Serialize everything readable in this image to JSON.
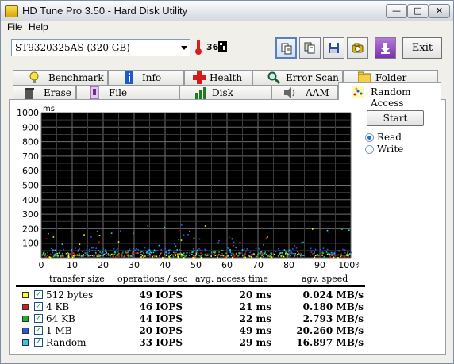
{
  "window": {
    "title": "HD Tune Pro 3.50 - Hard Disk Utility"
  },
  "menu": [
    {
      "label": "File"
    },
    {
      "label": "Help"
    }
  ],
  "toolbar": {
    "drive": "ST9320325AS (320 GB)",
    "temperature": "36",
    "temperature_unit_icon": "celsius-icon",
    "exit_label": "Exit"
  },
  "tabs_top": [
    {
      "label": "Benchmark",
      "icon": "lightbulb-icon"
    },
    {
      "label": "Info",
      "icon": "info-icon"
    },
    {
      "label": "Health",
      "icon": "red-cross-icon"
    },
    {
      "label": "Error Scan",
      "icon": "magnifier-icon"
    },
    {
      "label": "Folder Usage",
      "icon": "folder-icon"
    }
  ],
  "tabs_bottom": [
    {
      "label": "Erase",
      "icon": "trash-icon"
    },
    {
      "label": "File Benchmark",
      "icon": "file-benchmark-icon"
    },
    {
      "label": "Disk monitor",
      "icon": "bar-chart-icon"
    },
    {
      "label": "AAM",
      "icon": "speaker-icon"
    },
    {
      "label": "Random Access",
      "icon": "scatter-icon"
    }
  ],
  "controls": {
    "start_label": "Start",
    "read_label": "Read",
    "write_label": "Write",
    "selected_mode": "Read"
  },
  "chart_data": {
    "type": "scatter",
    "ylabel": "ms",
    "y_ticks": [
      "1000",
      "900",
      "800",
      "700",
      "600",
      "500",
      "400",
      "300",
      "200",
      "100"
    ],
    "x_ticks": [
      "0",
      "10",
      "20",
      "30",
      "40",
      "50",
      "60",
      "70",
      "80",
      "90",
      "100%"
    ],
    "xlim": [
      0,
      100
    ],
    "ylim": [
      0,
      1000
    ],
    "grid": true,
    "background": "#000000",
    "series": [
      {
        "color": "#ffff00",
        "band": [
          5,
          35
        ]
      },
      {
        "color": "#e01010",
        "band": [
          10,
          40
        ]
      },
      {
        "color": "#22c040",
        "band": [
          12,
          45
        ]
      },
      {
        "color": "#2a58ff",
        "band": [
          30,
          75
        ]
      },
      {
        "color": "#30d0e8",
        "band": [
          15,
          60
        ]
      }
    ]
  },
  "results": {
    "headers": [
      "transfer size",
      "operations / sec",
      "avg. access time",
      "agv. speed"
    ],
    "rows": [
      {
        "size": "512 bytes",
        "color": "#ffff00",
        "iops": "49 IOPS",
        "access": "20 ms",
        "speed": "0.024 MB/s"
      },
      {
        "size": "4 KB",
        "color": "#d81c1c",
        "iops": "46 IOPS",
        "access": "21 ms",
        "speed": "0.180 MB/s"
      },
      {
        "size": "64 KB",
        "color": "#22b122",
        "iops": "44 IOPS",
        "access": "22 ms",
        "speed": "2.793 MB/s"
      },
      {
        "size": "1 MB",
        "color": "#2a58d8",
        "iops": "20 IOPS",
        "access": "49 ms",
        "speed": "20.260 MB/s"
      },
      {
        "size": "Random",
        "color": "#34c8e0",
        "iops": "33 IOPS",
        "access": "29 ms",
        "speed": "16.897 MB/s"
      }
    ]
  }
}
